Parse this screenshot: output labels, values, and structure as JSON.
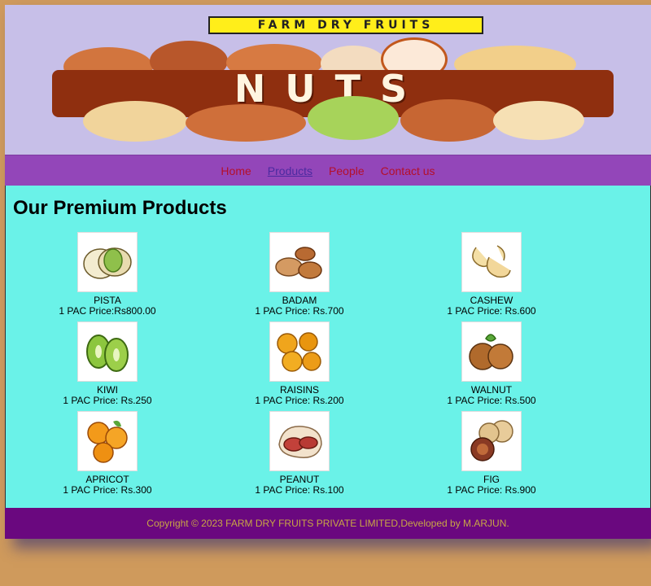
{
  "banner": {
    "brand": "FARM DRY FRUITS",
    "headline": "NUTS"
  },
  "nav": {
    "items": [
      {
        "label": "Home"
      },
      {
        "label": "Products"
      },
      {
        "label": "People"
      },
      {
        "label": "Contact us"
      }
    ],
    "active": "Products"
  },
  "main": {
    "title": "Our Premium Products",
    "products": [
      {
        "name": "PISTA",
        "price": "1 PAC Price:Rs800.00",
        "icon": "pistachio-icon"
      },
      {
        "name": "BADAM",
        "price": "1 PAC Price: Rs.700",
        "icon": "almond-icon"
      },
      {
        "name": "CASHEW",
        "price": "1 PAC Price: Rs.600",
        "icon": "cashew-icon"
      },
      {
        "name": "KIWI",
        "price": "1 PAC Price: Rs.250",
        "icon": "kiwi-icon"
      },
      {
        "name": "RAISINS",
        "price": "1 PAC Price: Rs.200",
        "icon": "raisins-icon"
      },
      {
        "name": "WALNUT",
        "price": "1 PAC Price: Rs.500",
        "icon": "walnut-icon"
      },
      {
        "name": "APRICOT",
        "price": "1 PAC Price: Rs.300",
        "icon": "apricot-icon"
      },
      {
        "name": "PEANUT",
        "price": "1 PAC Price: Rs.100",
        "icon": "peanut-icon"
      },
      {
        "name": "FIG",
        "price": "1 PAC Price: Rs.900",
        "icon": "fig-icon"
      }
    ]
  },
  "footer": {
    "text": "Copyright © 2023 FARM DRY FRUITS PRIVATE LIMITED,Developed by M.ARJUN."
  },
  "colors": {
    "page_bg": "#cf9a5c",
    "banner_bg": "#c7bfe8",
    "nav_bg": "#9346b9",
    "nav_link": "#b40f2a",
    "main_bg": "#6af2e8",
    "footer_bg": "#6a087f",
    "footer_text": "#c8a646"
  }
}
